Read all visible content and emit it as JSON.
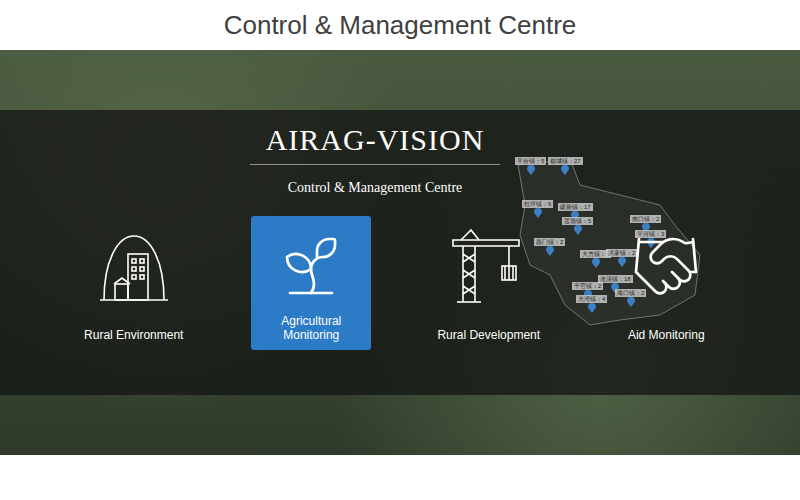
{
  "title": "Control & Management Centre",
  "brand": {
    "name": "AIRAG-VISION",
    "subtitle": "Control & Management Centre"
  },
  "modules": [
    {
      "label": "Rural Environment",
      "selected": false
    },
    {
      "label": "Agricultural Monitoring",
      "selected": true
    },
    {
      "label": "Rural Development",
      "selected": false
    },
    {
      "label": "Aid Monitoring",
      "selected": false
    }
  ],
  "map": {
    "pins": [
      {
        "label": "平台镇：5"
      },
      {
        "label": "都城镇：27"
      },
      {
        "label": "桂坪镇：6"
      },
      {
        "label": "建新镇：17"
      },
      {
        "label": "莲塘镇：5"
      },
      {
        "label": "南口镇：2"
      },
      {
        "label": "西门镇：2"
      },
      {
        "label": "大方镇：4"
      },
      {
        "label": "洪家镇：2"
      },
      {
        "label": "千官镇：2"
      },
      {
        "label": "大湾镇：4"
      },
      {
        "label": "道清镇：18"
      },
      {
        "label": "海口镇：2"
      },
      {
        "label": "平河镇：3"
      }
    ]
  }
}
